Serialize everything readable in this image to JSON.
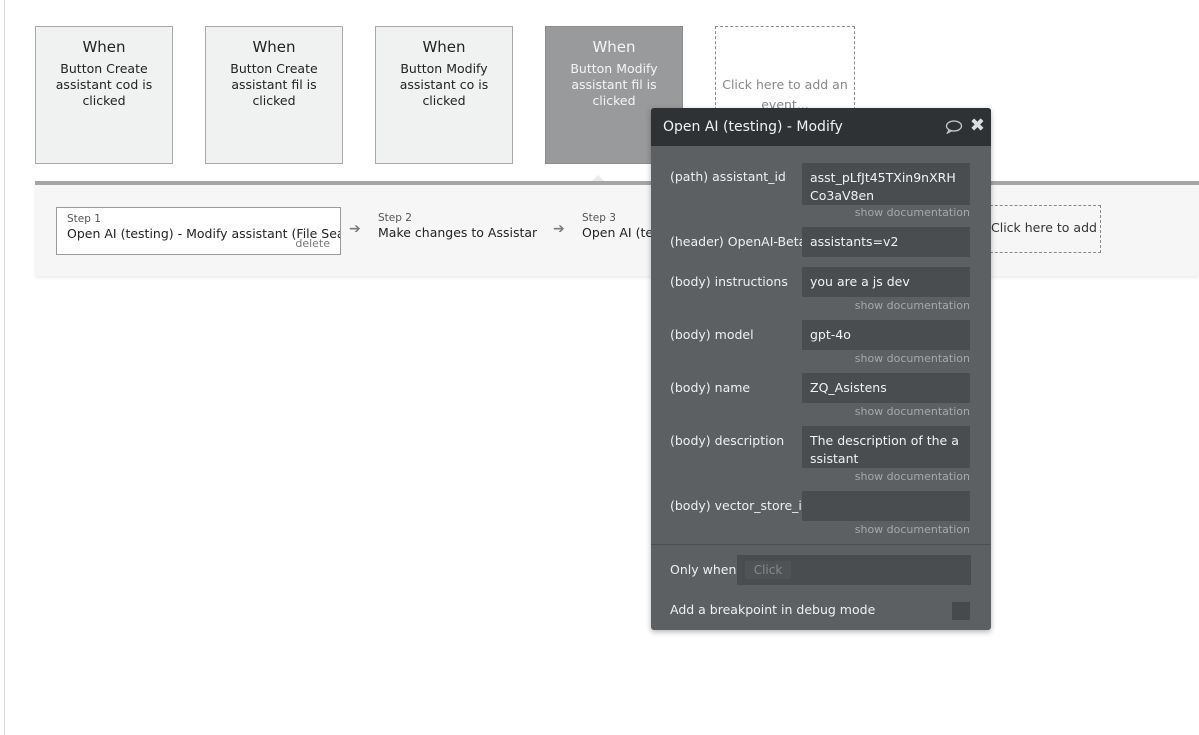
{
  "events": [
    {
      "when": "When",
      "desc": "Button Create assistant cod is clicked"
    },
    {
      "when": "When",
      "desc": "Button Create assistant fil is clicked"
    },
    {
      "when": "When",
      "desc": "Button Modify assistant co is clicked"
    },
    {
      "when": "When",
      "desc": "Button Modify assistant fil is clicked"
    }
  ],
  "add_event": "Click here to add an event...",
  "steps": [
    {
      "num": "Step 1",
      "title": "Open AI (testing) - Modify assistant (File Search)",
      "delete": "delete"
    },
    {
      "num": "Step 2",
      "title": "Make changes to Assistant..."
    },
    {
      "num": "Step 3",
      "title": "Open AI (testing) - Modify assistant"
    }
  ],
  "add_action": "Click here to add an action...",
  "panel": {
    "title": "Open AI (testing) - Modify",
    "doc_link": "show documentation",
    "fields": [
      {
        "label": "(path) assistant_id",
        "value": "asst_pLfJt45TXin9nXRHCo3aV8en"
      },
      {
        "label": "(header) OpenAI-Beta",
        "value": "assistants=v2"
      },
      {
        "label": "(body) instructions",
        "value": "you are a js dev"
      },
      {
        "label": "(body) model",
        "value": "gpt-4o"
      },
      {
        "label": "(body) name",
        "value": "ZQ_Asistens"
      },
      {
        "label": "(body) description",
        "value": "The description of the assistant"
      },
      {
        "label": "(body) vector_store_id",
        "value": ""
      }
    ],
    "only_when_label": "Only when",
    "only_when_click": "Click",
    "breakpoint_label": "Add a breakpoint in debug mode"
  },
  "colors": {
    "panel_bg": "#5c6063",
    "panel_header": "#2f3235",
    "input_bg": "#4a4d50",
    "active_event": "#999a9b"
  }
}
